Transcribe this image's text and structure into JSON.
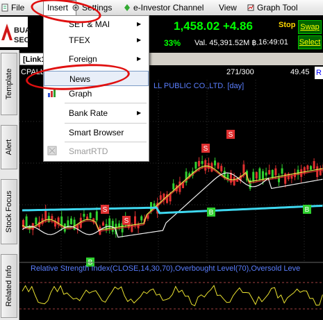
{
  "menubar": {
    "file": "File",
    "insert": "Insert",
    "settings": "Settings",
    "e_investor": "e-Investor Channel",
    "view": "View",
    "graph_tool": "Graph Tool"
  },
  "toolbar": {
    "logo_line1": "BUA",
    "logo_line2": "SEC",
    "price_change": "1,458.02 +4.86",
    "pct_change": "33%",
    "value": "Val. 45,391.52M ฿.",
    "time": "16:49:01",
    "stop": "Stop",
    "swap": "Swap",
    "select": "Select"
  },
  "sidebar": {
    "tabs": [
      "Template",
      "Alert",
      "Stock Focus",
      "Related Info"
    ]
  },
  "chart_tab": "[Link1",
  "infobar": {
    "symbol": "CPALL",
    "count": "271/300",
    "price": "49.45",
    "r_button": "R"
  },
  "chart": {
    "title": "LL PUBLIC CO.,LTD. [day]",
    "rsi_title": "Relative Strength Index(CLOSE,14,30,70),Overbought Level(70),Oversold Leve"
  },
  "insert_menu": {
    "items": [
      {
        "label": "SET & MAI",
        "submenu": true,
        "disabled": false
      },
      {
        "label": "TFEX",
        "submenu": true,
        "disabled": false
      },
      {
        "label": "Foreign",
        "submenu": true,
        "disabled": false
      },
      {
        "label": "News",
        "submenu": false,
        "disabled": false
      },
      {
        "label": "Graph",
        "submenu": false,
        "disabled": false
      },
      {
        "label": "Bank Rate",
        "submenu": true,
        "disabled": false
      },
      {
        "label": "Smart Browser",
        "submenu": false,
        "disabled": false
      },
      {
        "label": "SmartRTD",
        "submenu": false,
        "disabled": true
      }
    ]
  },
  "signal_markers": [
    "S",
    "S",
    "S",
    "S",
    "B",
    "B",
    "B"
  ],
  "colors": {
    "price_green": "#00ff00",
    "annotation_red": "#e01010",
    "ma_cyan": "#3fd8f0",
    "title_blue": "#5b7fff"
  }
}
